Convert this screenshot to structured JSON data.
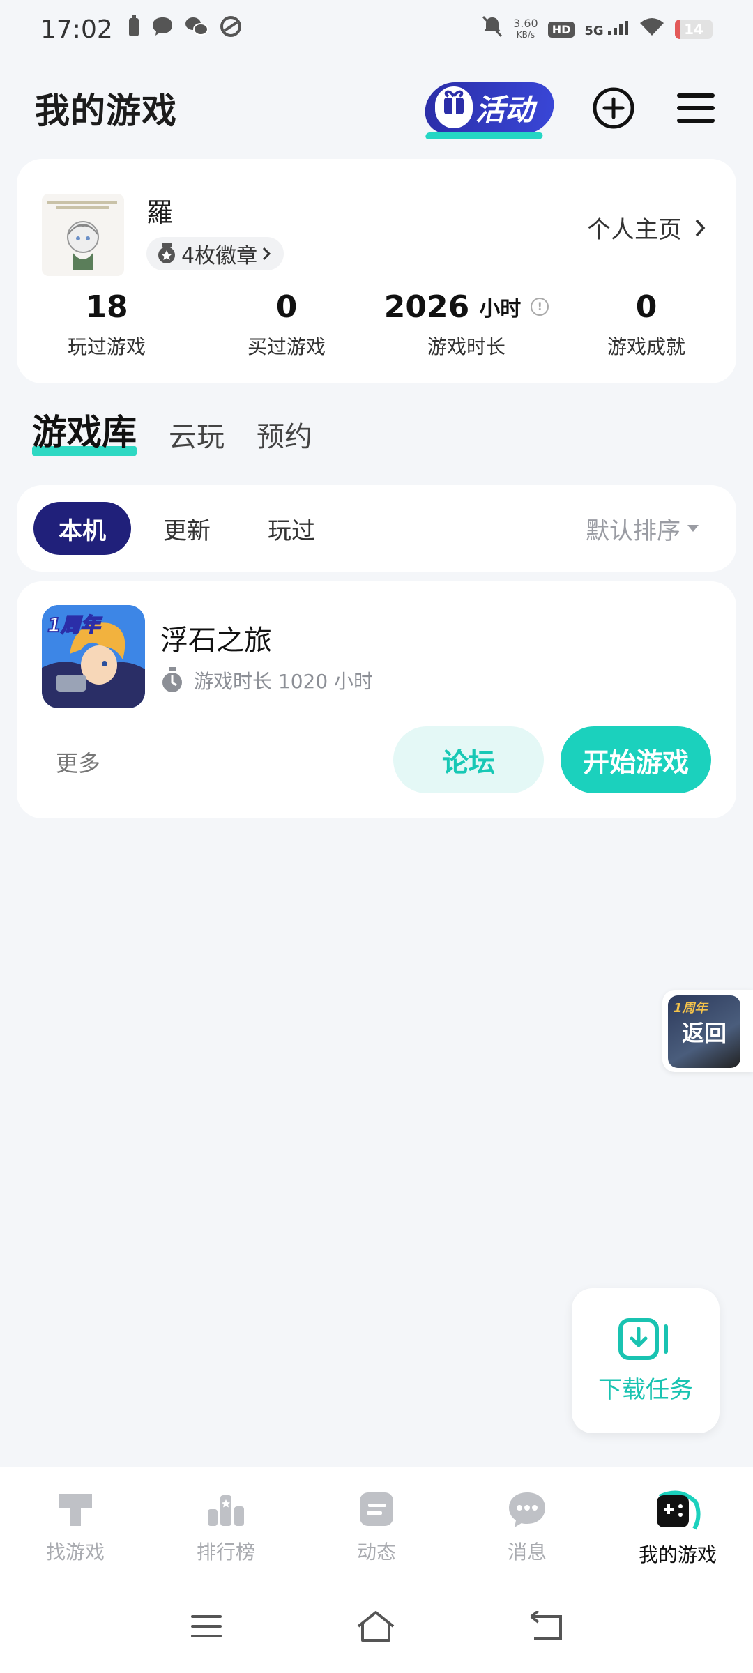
{
  "status_bar": {
    "time": "17:02",
    "net_speed_value": "3.60",
    "net_speed_unit": "KB/s",
    "hd": "HD",
    "network": "5G",
    "battery": "14",
    "battery_level": 0.14
  },
  "header": {
    "title": "我的游戏",
    "activity_label": "活动"
  },
  "profile": {
    "username": "羅",
    "badges": "4枚徽章",
    "home_link": "个人主页",
    "stats": [
      {
        "value": "18",
        "label": "玩过游戏"
      },
      {
        "value": "0",
        "label": "买过游戏"
      },
      {
        "value": "2026",
        "unit": "小时",
        "label": "游戏时长"
      },
      {
        "value": "0",
        "label": "游戏成就"
      }
    ]
  },
  "tabs": [
    "游戏库",
    "云玩",
    "预约"
  ],
  "filters": {
    "chips": [
      "本机",
      "更新",
      "玩过"
    ],
    "sort": "默认排序"
  },
  "game": {
    "name": "浮石之旅",
    "playtime": "游戏时长 1020 小时",
    "icon_badge": "1周年",
    "more": "更多",
    "forum": "论坛",
    "play": "开始游戏"
  },
  "float_back": {
    "label": "返回",
    "badge": "1周年"
  },
  "download_tasks": {
    "label": "下载任务"
  },
  "bottom_nav": [
    "找游戏",
    "排行榜",
    "动态",
    "消息",
    "我的游戏"
  ],
  "colors": {
    "accent": "#1bd1bd",
    "chip_active": "#20207a"
  }
}
